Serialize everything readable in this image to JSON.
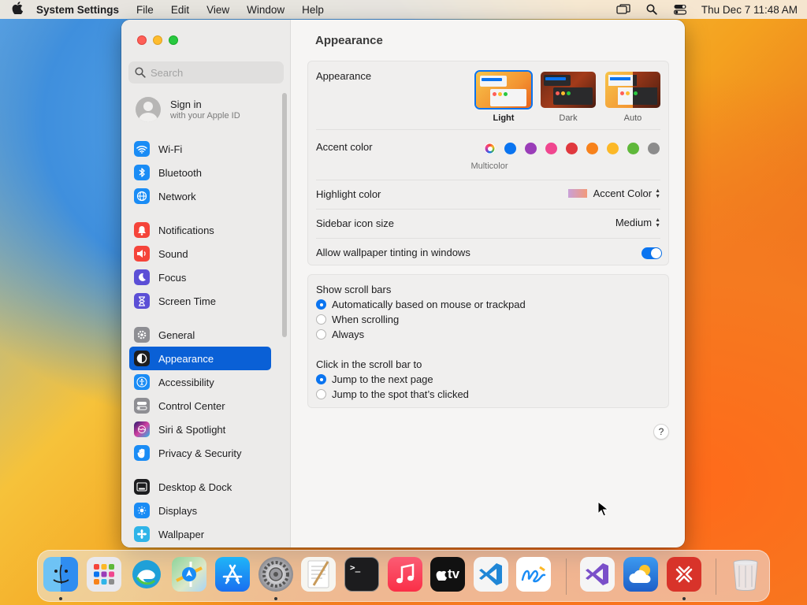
{
  "menubar": {
    "app_name": "System Settings",
    "menus": [
      "File",
      "Edit",
      "View",
      "Window",
      "Help"
    ],
    "clock": "Thu Dec 7  11:48 AM"
  },
  "sidebar": {
    "search_placeholder": "Search",
    "signin_title": "Sign in",
    "signin_subtitle": "with your Apple ID",
    "items": [
      {
        "label": "Wi-Fi",
        "icon": "wifi-icon",
        "color": "#1a8cf5"
      },
      {
        "label": "Bluetooth",
        "icon": "bluetooth-icon",
        "color": "#1a8cf5"
      },
      {
        "label": "Network",
        "icon": "globe-icon",
        "color": "#1a8cf5"
      },
      {
        "label": "Notifications",
        "icon": "bell-icon",
        "color": "#f5443a"
      },
      {
        "label": "Sound",
        "icon": "speaker-icon",
        "color": "#f5443a"
      },
      {
        "label": "Focus",
        "icon": "moon-icon",
        "color": "#5c4fd6"
      },
      {
        "label": "Screen Time",
        "icon": "hourglass-icon",
        "color": "#5c4fd6"
      },
      {
        "label": "General",
        "icon": "gear-icon",
        "color": "#8e8e93"
      },
      {
        "label": "Appearance",
        "icon": "appearance-icon",
        "color": "#1d1d1f"
      },
      {
        "label": "Accessibility",
        "icon": "accessibility-icon",
        "color": "#1a8cf5"
      },
      {
        "label": "Control Center",
        "icon": "control-center-icon",
        "color": "#8e8e93"
      },
      {
        "label": "Siri & Spotlight",
        "icon": "siri-icon",
        "color": "#7b3fe0"
      },
      {
        "label": "Privacy & Security",
        "icon": "hand-icon",
        "color": "#1a8cf5"
      },
      {
        "label": "Desktop & Dock",
        "icon": "dock-icon",
        "color": "#1d1d1f"
      },
      {
        "label": "Displays",
        "icon": "display-icon",
        "color": "#1a8cf5"
      },
      {
        "label": "Wallpaper",
        "icon": "wallpaper-icon",
        "color": "#2fb4e8"
      }
    ],
    "active_item": "Appearance"
  },
  "main": {
    "title": "Appearance",
    "appearance_label": "Appearance",
    "appearance_options": [
      "Light",
      "Dark",
      "Auto"
    ],
    "appearance_selected": "Light",
    "accent_label": "Accent color",
    "accent_colors": [
      "multicolor",
      "#0a74f0",
      "#9a3db8",
      "#f0468f",
      "#e0383e",
      "#f7821b",
      "#fcb827",
      "#5fb83a",
      "#8c8c8c"
    ],
    "accent_selected_label": "Multicolor",
    "highlight_label": "Highlight color",
    "highlight_value": "Accent Color",
    "sidebar_icon_label": "Sidebar icon size",
    "sidebar_icon_value": "Medium",
    "wallpaper_tint_label": "Allow wallpaper tinting in windows",
    "wallpaper_tint_on": true,
    "scroll_bars_label": "Show scroll bars",
    "scroll_bars_options": [
      "Automatically based on mouse or trackpad",
      "When scrolling",
      "Always"
    ],
    "scroll_bars_selected": 0,
    "click_scroll_label": "Click in the scroll bar to",
    "click_scroll_options": [
      "Jump to the next page",
      "Jump to the spot that’s clicked"
    ],
    "click_scroll_selected": 0,
    "help_label": "?"
  },
  "dock": {
    "apps": [
      {
        "name": "Finder",
        "icon": "finder-icon",
        "color": "#2f8df0",
        "running": true
      },
      {
        "name": "Launchpad",
        "icon": "launchpad-icon",
        "color": "#e9e9ee",
        "running": false
      },
      {
        "name": "Microsoft Edge",
        "icon": "edge-icon",
        "color": "#1fa0d8",
        "running": false
      },
      {
        "name": "Maps",
        "icon": "maps-icon",
        "color": "#6cc06c",
        "running": false
      },
      {
        "name": "App Store",
        "icon": "app-store-icon",
        "color": "#1b8cf3",
        "running": false
      },
      {
        "name": "System Settings",
        "icon": "settings-icon",
        "color": "#8b8b90",
        "running": true
      },
      {
        "name": "TextEdit",
        "icon": "textedit-icon",
        "color": "#f1f1f1",
        "running": false
      },
      {
        "name": "Terminal",
        "icon": "terminal-icon",
        "color": "#1c1c1e",
        "running": false
      },
      {
        "name": "Music",
        "icon": "music-icon",
        "color": "#fa2f47",
        "running": false
      },
      {
        "name": "Apple TV",
        "icon": "tv-icon",
        "color": "#111111",
        "running": false
      },
      {
        "name": "Visual Studio Code",
        "icon": "vscode-icon",
        "color": "#f5f5f5",
        "running": false
      },
      {
        "name": "Freeform",
        "icon": "freeform-icon",
        "color": "#ffffff",
        "running": false
      },
      {
        "name": "Visual Studio",
        "icon": "visual-studio-icon",
        "color": "#f5f5f5",
        "running": false
      },
      {
        "name": "Weather",
        "icon": "weather-icon",
        "color": "#2a7de0",
        "running": false
      },
      {
        "name": "Remote Desktop",
        "icon": "remote-desktop-icon",
        "color": "#d8332a",
        "running": true
      },
      {
        "name": "Trash",
        "icon": "trash-icon",
        "color": "#e8e8e8",
        "running": false
      }
    ],
    "appletv_text": "tv",
    "terminal_text": ">_"
  }
}
